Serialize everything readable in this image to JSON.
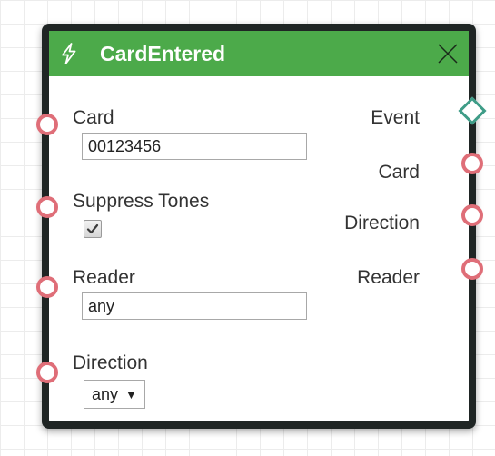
{
  "node": {
    "title": "CardEntered",
    "header_color": "#4caa4a",
    "icons": {
      "header": "lightning-bolt-icon",
      "close": "close-icon"
    }
  },
  "inputs": {
    "card": {
      "label": "Card",
      "value": "00123456"
    },
    "suppress_tones": {
      "label": "Suppress Tones",
      "checked": true
    },
    "reader": {
      "label": "Reader",
      "value": "any"
    },
    "direction": {
      "label": "Direction",
      "selected": "any",
      "arrow": "▼"
    }
  },
  "outputs": {
    "event": "Event",
    "card": "Card",
    "direction": "Direction",
    "reader": "Reader"
  },
  "colors": {
    "port_ring": "#df6e78",
    "event_port": "#3e9c87",
    "node_border": "#1f2524"
  }
}
